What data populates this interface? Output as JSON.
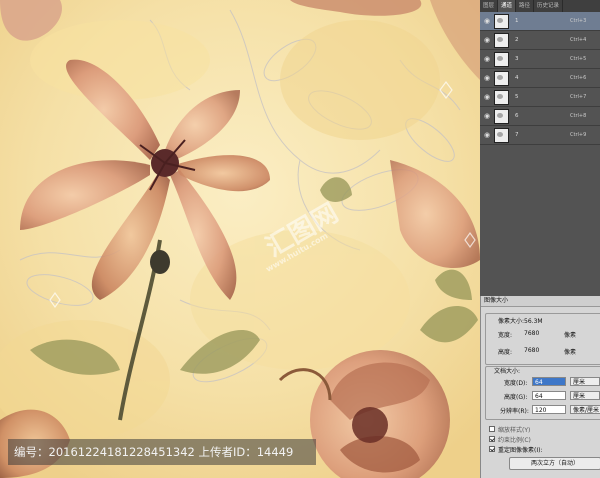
{
  "watermark": {
    "id_text": "编号：20161224181228451342 上传者ID：14449",
    "logo_text": "汇图网",
    "logo_url": "www.huitu.com"
  },
  "panel": {
    "tabs": [
      "图层",
      "通道",
      "路径",
      "历史记录"
    ],
    "active_tab": 1,
    "channels": [
      {
        "name": "1",
        "shortcut": "Ctrl+3"
      },
      {
        "name": "2",
        "shortcut": "Ctrl+4"
      },
      {
        "name": "3",
        "shortcut": "Ctrl+5"
      },
      {
        "name": "4",
        "shortcut": "Ctrl+6"
      },
      {
        "name": "5",
        "shortcut": "Ctrl+7"
      },
      {
        "name": "6",
        "shortcut": "Ctrl+8"
      },
      {
        "name": "7",
        "shortcut": "Ctrl+9"
      }
    ],
    "selected_channel": 0
  },
  "dialog": {
    "title": "图像大小",
    "pixel_size_label": "像素大小:56.3M",
    "width_label": "宽度:",
    "width_value": "7680",
    "width_unit": "像素",
    "height_label": "高度:",
    "height_value": "7680",
    "height_unit": "像素",
    "doc_size_label": "文档大小:",
    "doc_width_label": "宽度(D):",
    "doc_width_value": "64",
    "doc_width_unit": "厘米",
    "doc_height_label": "高度(G):",
    "doc_height_value": "64",
    "doc_height_unit": "厘米",
    "resolution_label": "分辨率(R):",
    "resolution_value": "120",
    "resolution_unit": "像素/厘米",
    "scale_styles_label": "缩放样式(Y)",
    "constrain_label": "约束比例(C)",
    "resample_label": "重定图像像素(I):",
    "resample_method": "两次立方（自动）"
  },
  "colors": {
    "panel_bg": "#535353",
    "selected_row": "#6f7d92",
    "dialog_bg": "#d6d6d6",
    "canvas_bg": "#f3dfa8"
  }
}
